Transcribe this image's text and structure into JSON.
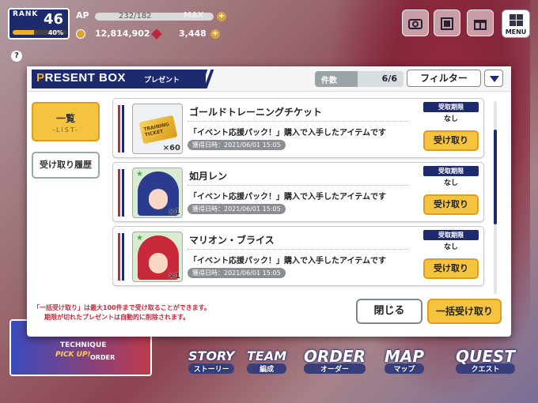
{
  "hud": {
    "rank_label": "RANK",
    "rank_value": "46",
    "rank_progress_text": "40%",
    "rank_progress": 0.4,
    "ap_label": "AP",
    "ap_value": "232/182",
    "ap_max": "MAX",
    "coins": "12,814,902",
    "gems": "3,448",
    "menu_label": "MENU",
    "help": "?"
  },
  "dialog": {
    "title_first": "P",
    "title_rest": "RESENT BOX",
    "subtitle": "プレゼント",
    "count_label": "件数",
    "count_value": "6/6",
    "filter_label": "フィルター",
    "side_list_label": "一覧",
    "side_list_sub": "-LIST-",
    "side_history_label": "受け取り履歴",
    "note_line1": "「一括受け取り」は最大100件まで受け取ることができます。",
    "note_line2": "期限が切れたプレゼントは自動的に削除されます。",
    "close_label": "閉じる",
    "bulk_label": "一括受け取り"
  },
  "items": [
    {
      "name": "ゴールドトレーニングチケット",
      "desc": "「イベント応援パック！」購入で入手したアイテムです",
      "date": "獲得日時：2021/06/01 15:05",
      "expiry_label": "受取期限",
      "expiry_value": "なし",
      "receive_label": "受け取り",
      "qty": "×60",
      "ticket_text": "TRAINING TICKET",
      "thumb_icon": "gold-ticket-icon"
    },
    {
      "name": "如月レン",
      "desc": "「イベント応援パック！」購入で入手したアイテムです",
      "date": "獲得日時：2021/06/01 15:05",
      "expiry_label": "受取期限",
      "expiry_value": "なし",
      "receive_label": "受け取り",
      "qty": "×1",
      "thumb_icon": "character-portrait-icon",
      "hair_color": "#2b3b8f"
    },
    {
      "name": "マリオン・ブライス",
      "desc": "「イベント応援パック！」購入で入手したアイテムです",
      "date": "獲得日時：2021/06/01 15:05",
      "expiry_label": "受取期限",
      "expiry_value": "なし",
      "receive_label": "受け取り",
      "qty": "×1",
      "thumb_icon": "character-portrait-icon",
      "hair_color": "#c8283a"
    }
  ],
  "nav": {
    "story_en": "STORY",
    "story_jp": "ストーリー",
    "team_en": "TEAM",
    "team_jp": "編成",
    "order_en": "ORDER",
    "order_jp": "オーダー",
    "map_en": "MAP",
    "map_jp": "マップ",
    "quest_en": "QUEST",
    "quest_jp": "クエスト",
    "technique_title": "TECHNIQUE",
    "technique_pickup": "PICK UP!",
    "technique_order": "ORDER"
  },
  "colors": {
    "navy": "#1e2a6e",
    "accent_yellow": "#f4c441",
    "accent_red": "#c8283a"
  }
}
